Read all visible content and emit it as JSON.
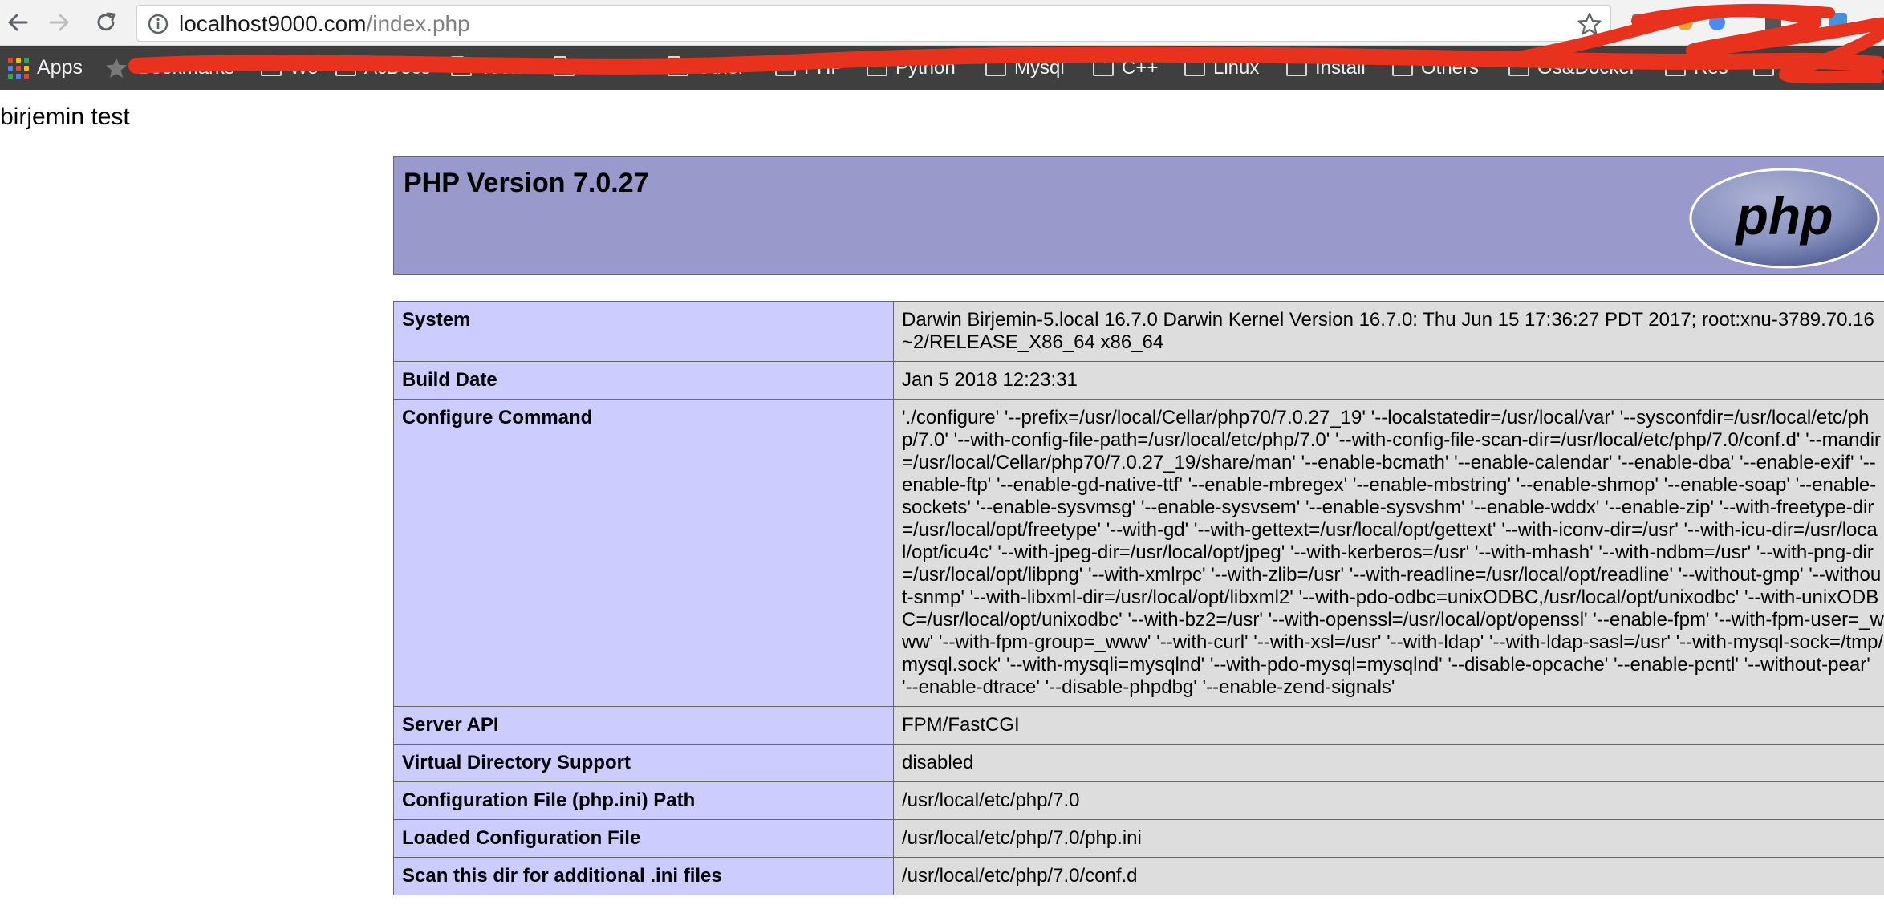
{
  "browser": {
    "url_host": "localhost9000.com",
    "url_path": "/index.php",
    "apps_label": "Apps",
    "bookmarks": [
      {
        "label": "Bookmarks"
      },
      {
        "label": "Wo"
      },
      {
        "label": "AcDocs"
      },
      {
        "label": "Tools"
      },
      {
        "label": "Github"
      },
      {
        "label": "Other"
      },
      {
        "label": "PHP"
      },
      {
        "label": "Python"
      },
      {
        "label": "Mysql"
      },
      {
        "label": "C++"
      },
      {
        "label": "Linux"
      },
      {
        "label": "Install"
      },
      {
        "label": "Others"
      },
      {
        "label": "Os&Docker"
      },
      {
        "label": "Res"
      },
      {
        "label": "Git"
      }
    ]
  },
  "page": {
    "heading": "birjemin test"
  },
  "phpinfo": {
    "title": "PHP Version 7.0.27",
    "logo_text": "php",
    "rows": [
      {
        "key": "System",
        "value": "Darwin Birjemin-5.local 16.7.0 Darwin Kernel Version 16.7.0: Thu Jun 15 17:36:27 PDT 2017; root:xnu-3789.70.16~2/RELEASE_X86_64 x86_64"
      },
      {
        "key": "Build Date",
        "value": "Jan 5 2018 12:23:31"
      },
      {
        "key": "Configure Command",
        "value": "'./configure' '--prefix=/usr/local/Cellar/php70/7.0.27_19' '--localstatedir=/usr/local/var' '--sysconfdir=/usr/local/etc/php/7.0' '--with-config-file-path=/usr/local/etc/php/7.0' '--with-config-file-scan-dir=/usr/local/etc/php/7.0/conf.d' '--mandir=/usr/local/Cellar/php70/7.0.27_19/share/man' '--enable-bcmath' '--enable-calendar' '--enable-dba' '--enable-exif' '--enable-ftp' '--enable-gd-native-ttf' '--enable-mbregex' '--enable-mbstring' '--enable-shmop' '--enable-soap' '--enable-sockets' '--enable-sysvmsg' '--enable-sysvsem' '--enable-sysvshm' '--enable-wddx' '--enable-zip' '--with-freetype-dir=/usr/local/opt/freetype' '--with-gd' '--with-gettext=/usr/local/opt/gettext' '--with-iconv-dir=/usr' '--with-icu-dir=/usr/local/opt/icu4c' '--with-jpeg-dir=/usr/local/opt/jpeg' '--with-kerberos=/usr' '--with-mhash' '--with-ndbm=/usr' '--with-png-dir=/usr/local/opt/libpng' '--with-xmlrpc' '--with-zlib=/usr' '--with-readline=/usr/local/opt/readline' '--without-gmp' '--without-snmp' '--with-libxml-dir=/usr/local/opt/libxml2' '--with-pdo-odbc=unixODBC,/usr/local/opt/unixodbc' '--with-unixODBC=/usr/local/opt/unixodbc' '--with-bz2=/usr' '--with-openssl=/usr/local/opt/openssl' '--enable-fpm' '--with-fpm-user=_www' '--with-fpm-group=_www' '--with-curl' '--with-xsl=/usr' '--with-ldap' '--with-ldap-sasl=/usr' '--with-mysql-sock=/tmp/mysql.sock' '--with-mysqli=mysqlnd' '--with-pdo-mysql=mysqlnd' '--disable-opcache' '--enable-pcntl' '--without-pear' '--enable-dtrace' '--disable-phpdbg' '--enable-zend-signals'"
      },
      {
        "key": "Server API",
        "value": "FPM/FastCGI"
      },
      {
        "key": "Virtual Directory Support",
        "value": "disabled"
      },
      {
        "key": "Configuration File (php.ini) Path",
        "value": "/usr/local/etc/php/7.0"
      },
      {
        "key": "Loaded Configuration File",
        "value": "/usr/local/etc/php/7.0/php.ini"
      },
      {
        "key": "Scan this dir for additional .ini files",
        "value": "/usr/local/etc/php/7.0/conf.d"
      }
    ]
  },
  "colors": {
    "header_bg": "#9999cc",
    "key_bg": "#ccccff",
    "value_bg": "#dddddd",
    "redaction": "#e8321e",
    "bookmarks_bar_bg": "#3f3f3f"
  },
  "icons": [
    "back-arrow-icon",
    "forward-arrow-icon",
    "reload-icon",
    "info-icon",
    "bookmark-star-icon",
    "apps-grid-icon",
    "folder-icon",
    "php-logo"
  ]
}
